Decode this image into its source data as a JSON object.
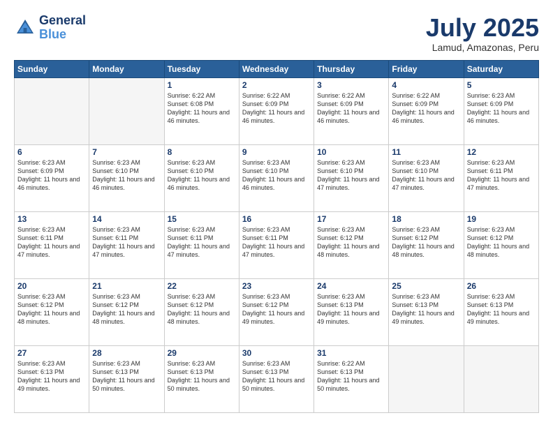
{
  "logo": {
    "line1": "General",
    "line2": "Blue"
  },
  "title": "July 2025",
  "location": "Lamud, Amazonas, Peru",
  "days_of_week": [
    "Sunday",
    "Monday",
    "Tuesday",
    "Wednesday",
    "Thursday",
    "Friday",
    "Saturday"
  ],
  "weeks": [
    [
      {
        "day": "",
        "info": ""
      },
      {
        "day": "",
        "info": ""
      },
      {
        "day": "1",
        "info": "Sunrise: 6:22 AM\nSunset: 6:08 PM\nDaylight: 11 hours and 46 minutes."
      },
      {
        "day": "2",
        "info": "Sunrise: 6:22 AM\nSunset: 6:09 PM\nDaylight: 11 hours and 46 minutes."
      },
      {
        "day": "3",
        "info": "Sunrise: 6:22 AM\nSunset: 6:09 PM\nDaylight: 11 hours and 46 minutes."
      },
      {
        "day": "4",
        "info": "Sunrise: 6:22 AM\nSunset: 6:09 PM\nDaylight: 11 hours and 46 minutes."
      },
      {
        "day": "5",
        "info": "Sunrise: 6:23 AM\nSunset: 6:09 PM\nDaylight: 11 hours and 46 minutes."
      }
    ],
    [
      {
        "day": "6",
        "info": "Sunrise: 6:23 AM\nSunset: 6:09 PM\nDaylight: 11 hours and 46 minutes."
      },
      {
        "day": "7",
        "info": "Sunrise: 6:23 AM\nSunset: 6:10 PM\nDaylight: 11 hours and 46 minutes."
      },
      {
        "day": "8",
        "info": "Sunrise: 6:23 AM\nSunset: 6:10 PM\nDaylight: 11 hours and 46 minutes."
      },
      {
        "day": "9",
        "info": "Sunrise: 6:23 AM\nSunset: 6:10 PM\nDaylight: 11 hours and 46 minutes."
      },
      {
        "day": "10",
        "info": "Sunrise: 6:23 AM\nSunset: 6:10 PM\nDaylight: 11 hours and 47 minutes."
      },
      {
        "day": "11",
        "info": "Sunrise: 6:23 AM\nSunset: 6:10 PM\nDaylight: 11 hours and 47 minutes."
      },
      {
        "day": "12",
        "info": "Sunrise: 6:23 AM\nSunset: 6:11 PM\nDaylight: 11 hours and 47 minutes."
      }
    ],
    [
      {
        "day": "13",
        "info": "Sunrise: 6:23 AM\nSunset: 6:11 PM\nDaylight: 11 hours and 47 minutes."
      },
      {
        "day": "14",
        "info": "Sunrise: 6:23 AM\nSunset: 6:11 PM\nDaylight: 11 hours and 47 minutes."
      },
      {
        "day": "15",
        "info": "Sunrise: 6:23 AM\nSunset: 6:11 PM\nDaylight: 11 hours and 47 minutes."
      },
      {
        "day": "16",
        "info": "Sunrise: 6:23 AM\nSunset: 6:11 PM\nDaylight: 11 hours and 47 minutes."
      },
      {
        "day": "17",
        "info": "Sunrise: 6:23 AM\nSunset: 6:12 PM\nDaylight: 11 hours and 48 minutes."
      },
      {
        "day": "18",
        "info": "Sunrise: 6:23 AM\nSunset: 6:12 PM\nDaylight: 11 hours and 48 minutes."
      },
      {
        "day": "19",
        "info": "Sunrise: 6:23 AM\nSunset: 6:12 PM\nDaylight: 11 hours and 48 minutes."
      }
    ],
    [
      {
        "day": "20",
        "info": "Sunrise: 6:23 AM\nSunset: 6:12 PM\nDaylight: 11 hours and 48 minutes."
      },
      {
        "day": "21",
        "info": "Sunrise: 6:23 AM\nSunset: 6:12 PM\nDaylight: 11 hours and 48 minutes."
      },
      {
        "day": "22",
        "info": "Sunrise: 6:23 AM\nSunset: 6:12 PM\nDaylight: 11 hours and 48 minutes."
      },
      {
        "day": "23",
        "info": "Sunrise: 6:23 AM\nSunset: 6:12 PM\nDaylight: 11 hours and 49 minutes."
      },
      {
        "day": "24",
        "info": "Sunrise: 6:23 AM\nSunset: 6:13 PM\nDaylight: 11 hours and 49 minutes."
      },
      {
        "day": "25",
        "info": "Sunrise: 6:23 AM\nSunset: 6:13 PM\nDaylight: 11 hours and 49 minutes."
      },
      {
        "day": "26",
        "info": "Sunrise: 6:23 AM\nSunset: 6:13 PM\nDaylight: 11 hours and 49 minutes."
      }
    ],
    [
      {
        "day": "27",
        "info": "Sunrise: 6:23 AM\nSunset: 6:13 PM\nDaylight: 11 hours and 49 minutes."
      },
      {
        "day": "28",
        "info": "Sunrise: 6:23 AM\nSunset: 6:13 PM\nDaylight: 11 hours and 50 minutes."
      },
      {
        "day": "29",
        "info": "Sunrise: 6:23 AM\nSunset: 6:13 PM\nDaylight: 11 hours and 50 minutes."
      },
      {
        "day": "30",
        "info": "Sunrise: 6:23 AM\nSunset: 6:13 PM\nDaylight: 11 hours and 50 minutes."
      },
      {
        "day": "31",
        "info": "Sunrise: 6:22 AM\nSunset: 6:13 PM\nDaylight: 11 hours and 50 minutes."
      },
      {
        "day": "",
        "info": ""
      },
      {
        "day": "",
        "info": ""
      }
    ]
  ]
}
